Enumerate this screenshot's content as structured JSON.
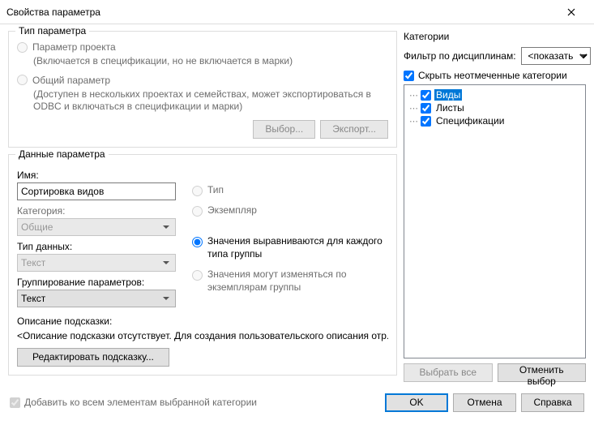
{
  "window": {
    "title": "Свойства параметра"
  },
  "paramType": {
    "legend": "Тип параметра",
    "project": {
      "label": "Параметр проекта",
      "hint": "(Включается в спецификации, но не включается в марки)"
    },
    "shared": {
      "label": "Общий параметр",
      "hint": "(Доступен в нескольких проектах и семействах, может экспортироваться в ODBC и включаться в спецификации и марки)"
    },
    "btnSelect": "Выбор...",
    "btnExport": "Экспорт..."
  },
  "paramData": {
    "legend": "Данные параметра",
    "nameLabel": "Имя:",
    "nameValue": "Сортировка видов",
    "categoryLabel": "Категория:",
    "categoryValue": "Общие",
    "typeLabel": "Тип данных:",
    "typeValue": "Текст",
    "groupLabel": "Группирование параметров:",
    "groupValue": "Текст",
    "radioType": "Тип",
    "radioInstance": "Экземпляр",
    "radioAlign": "Значения выравниваются для каждого типа группы",
    "radioVary": "Значения могут изменяться по экземплярам группы",
    "tooltipLabel": "Описание подсказки:",
    "tooltipPreview": "<Описание подсказки отсутствует. Для создания пользовательского описания отр...",
    "btnEditTooltip": "Редактировать подсказку..."
  },
  "categories": {
    "legend": "Категории",
    "filterLabel": "Фильтр по дисциплинам:",
    "filterValue": "<показать",
    "hideUnchecked": "Скрыть неотмеченные категории",
    "items": [
      {
        "label": "Виды",
        "checked": true,
        "selected": true
      },
      {
        "label": "Листы",
        "checked": true,
        "selected": false
      },
      {
        "label": "Спецификации",
        "checked": true,
        "selected": false
      }
    ],
    "btnSelectAll": "Выбрать все",
    "btnDeselect": "Отменить выбор"
  },
  "footer": {
    "addToAll": "Добавить ко всем элементам выбранной категории",
    "ok": "OK",
    "cancel": "Отмена",
    "help": "Справка"
  }
}
